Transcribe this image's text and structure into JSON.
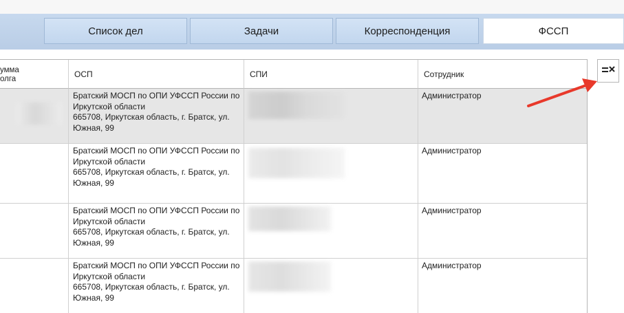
{
  "tabs": [
    {
      "label": "Список дел"
    },
    {
      "label": "Задачи"
    },
    {
      "label": "Корреспонденция"
    },
    {
      "label": "ФССП",
      "active": true
    }
  ],
  "columns": {
    "debt": "умма\nолга",
    "osp": "ОСП",
    "spi": "СПИ",
    "employee": "Сотрудник"
  },
  "rows": [
    {
      "osp_name": "Братский МОСП по ОПИ УФССП России по Иркутской области",
      "osp_address": "665708, Иркутская область, г. Братск, ул. Южная, 99",
      "employee": "Администратор",
      "selected": true
    },
    {
      "osp_name": "Братский МОСП по ОПИ УФССП России по Иркутской области",
      "osp_address": "665708, Иркутская область, г. Братск, ул. Южная, 99",
      "employee": "Администратор"
    },
    {
      "osp_name": "Братский МОСП по ОПИ УФССП России по Иркутской области",
      "osp_address": "665708, Иркутская область, г. Братск, ул. Южная, 99",
      "employee": "Администратор"
    },
    {
      "osp_name": "Братский МОСП по ОПИ УФССП России по Иркутской области",
      "osp_address": "665708, Иркутская область, г. Братск, ул. Южная, 99",
      "employee": "Администратор"
    }
  ],
  "colors": {
    "annotation_arrow": "#e8392b"
  },
  "icons": {
    "column_chooser": "column-chooser-icon"
  }
}
